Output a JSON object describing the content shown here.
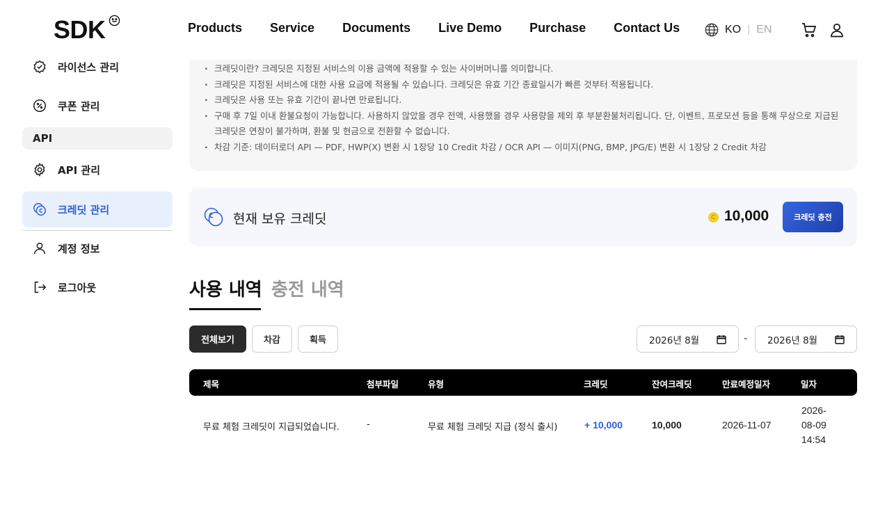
{
  "header": {
    "logo": "SDK",
    "nav": [
      "Products",
      "Service",
      "Documents",
      "Live Demo",
      "Purchase",
      "Contact Us"
    ],
    "lang_ko": "KO",
    "lang_sep": "|",
    "lang_en": "EN"
  },
  "sidebar": {
    "license": "라이선스 관리",
    "coupon": "쿠폰 관리",
    "section_api": "API",
    "api_manage": "API 관리",
    "credit_manage": "크레딧 관리",
    "account": "계정 정보",
    "logout": "로그아웃"
  },
  "notice": [
    "크레딧이란? 크레딧은 지정된 서비스의 이용 금액에 적용할 수 있는 사이버머니를 의미합니다.",
    "크레딧은 지정된 서비스에 대한 사용 요금에 적용될 수 있습니다. 크레딧은 유효 기간 종료일시가 빠른 것부터 적용됩니다.",
    "크레딧은 사용 또는 유효 기간이 끝나면 만료됩니다.",
    "구매 후 7일 이내 환불요청이 가능합니다. 사용하지 않았을 경우 전액, 사용했을 경우 사용량을 제외 후 부분환불처리됩니다. 단, 이벤트, 프로모션 등을 통해 무상으로 지급된 크레딧은 연장이 불가하며, 환불 및 현금으로 전환할 수 없습니다.",
    "차감 기준: 데이터로더 API — PDF, HWP(X) 변환 시 1장당 10 Credit 차감 / OCR API — 이미지(PNG, BMP, JPG/E) 변환 시 1장당 2 Credit 차감"
  ],
  "credit": {
    "label": "현재 보유 크레딧",
    "coin": "C",
    "amount": "10,000",
    "charge_button": "크레딧 충전"
  },
  "tabs": {
    "usage": "사용 내역",
    "charge": "충전 내역"
  },
  "filters": {
    "all": "전체보기",
    "deduct": "차감",
    "gain": "획득",
    "date_from": "2026년 8월",
    "date_to": "2026년 8월",
    "dash": "-"
  },
  "table": {
    "headers": [
      "제목",
      "첨부파일",
      "유형",
      "크레딧",
      "잔여크레딧",
      "만료예정일자",
      "일자"
    ],
    "rows": [
      [
        "무료 체험 크레딧이 지급되었습니다.",
        "-",
        "무료 체험 크레딧 지급 (정식 출시)",
        "+ 10,000",
        "10,000",
        "2026-11-07",
        "2026-08-09 14:54"
      ]
    ]
  },
  "colors": {
    "accent": "#2c5fd6",
    "sidebar_active_bg": "#e9f0fd",
    "coin": "#f6cf2b"
  }
}
